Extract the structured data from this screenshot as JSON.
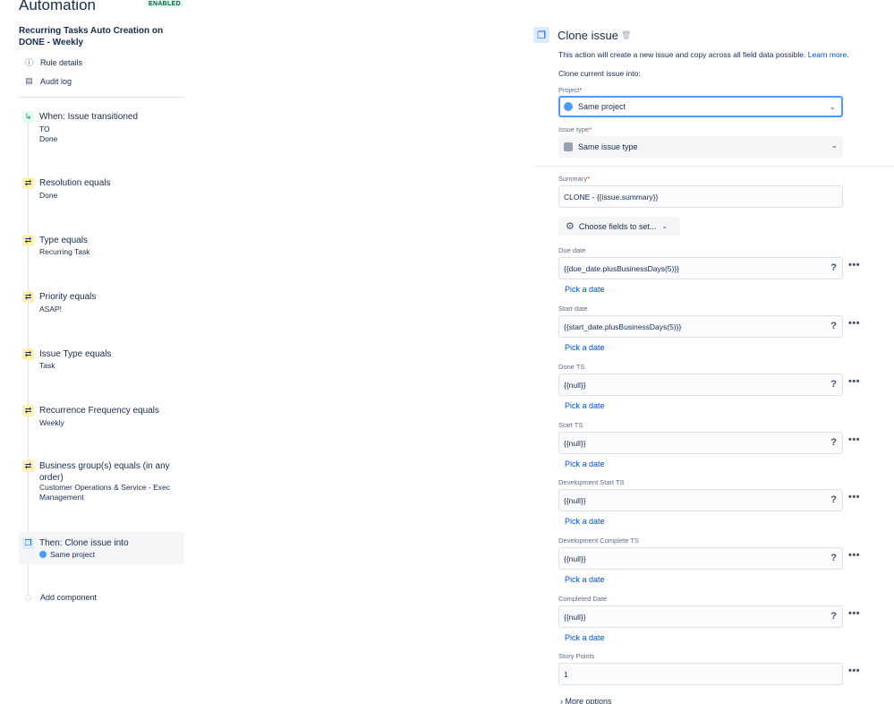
{
  "app": {
    "title": "Automation",
    "status_badge": "ENABLED"
  },
  "rule": {
    "name": "Recurring Tasks Auto Creation on DONE - Weekly",
    "nav": [
      {
        "label": "Rule details",
        "icon": "info-icon"
      },
      {
        "label": "Audit log",
        "icon": "document-icon"
      }
    ]
  },
  "components": [
    {
      "kind": "trigger",
      "icon": "trigger-icon",
      "title": "When: Issue transitioned",
      "sub1": "TO",
      "sub2": "Done"
    },
    {
      "kind": "condition",
      "icon": "condition-icon",
      "title": "Resolution equals",
      "sub1": "Done"
    },
    {
      "kind": "condition",
      "icon": "condition-icon",
      "title": "Type equals",
      "sub1": "Recurring Task"
    },
    {
      "kind": "condition",
      "icon": "condition-icon",
      "title": "Priority equals",
      "sub1": "ASAP!"
    },
    {
      "kind": "condition",
      "icon": "condition-icon",
      "title": "Issue Type equals",
      "sub1": "Task"
    },
    {
      "kind": "condition",
      "icon": "condition-icon",
      "title": "Recurrence Frequency equals",
      "sub1": "Weekly"
    },
    {
      "kind": "condition",
      "icon": "condition-icon",
      "title": "Business group(s) equals (in any order)",
      "sub1": "Customer Operations & Service - Exec Management"
    },
    {
      "kind": "action",
      "icon": "clone-icon",
      "title": "Then: Clone issue into",
      "sub1": "Same project"
    }
  ],
  "add_component": "Add component",
  "panel": {
    "title": "Clone issue",
    "description": "This action will create a new issue and copy across all field data possible.",
    "learn_more": "Learn more.",
    "clone_into": "Clone current issue into:",
    "project": {
      "label": "Project",
      "value": "Same project"
    },
    "issue_type": {
      "label": "Issue type",
      "value": "Same issue type"
    },
    "summary": {
      "label": "Summary",
      "value": "CLONE - {{issue.summary}}"
    },
    "choose_fields": "Choose fields to set...",
    "pick_date": "Pick a date",
    "fields": [
      {
        "label": "Due date",
        "value": "{{due_date.plusBusinessDays(5)}}"
      },
      {
        "label": "Start date",
        "value": "{{start_date.plusBusinessDays(5)}}"
      },
      {
        "label": "Done TS",
        "value": "{{null}}"
      },
      {
        "label": "Start TS",
        "value": "{{null}}"
      },
      {
        "label": "Development Start TS",
        "value": "{{null}}"
      },
      {
        "label": "Development Complete TS",
        "value": "{{null}}"
      },
      {
        "label": "Completed Date",
        "value": "{{null}}"
      }
    ],
    "story_points": {
      "label": "Story Points",
      "value": "1"
    },
    "more_options": "More options"
  }
}
